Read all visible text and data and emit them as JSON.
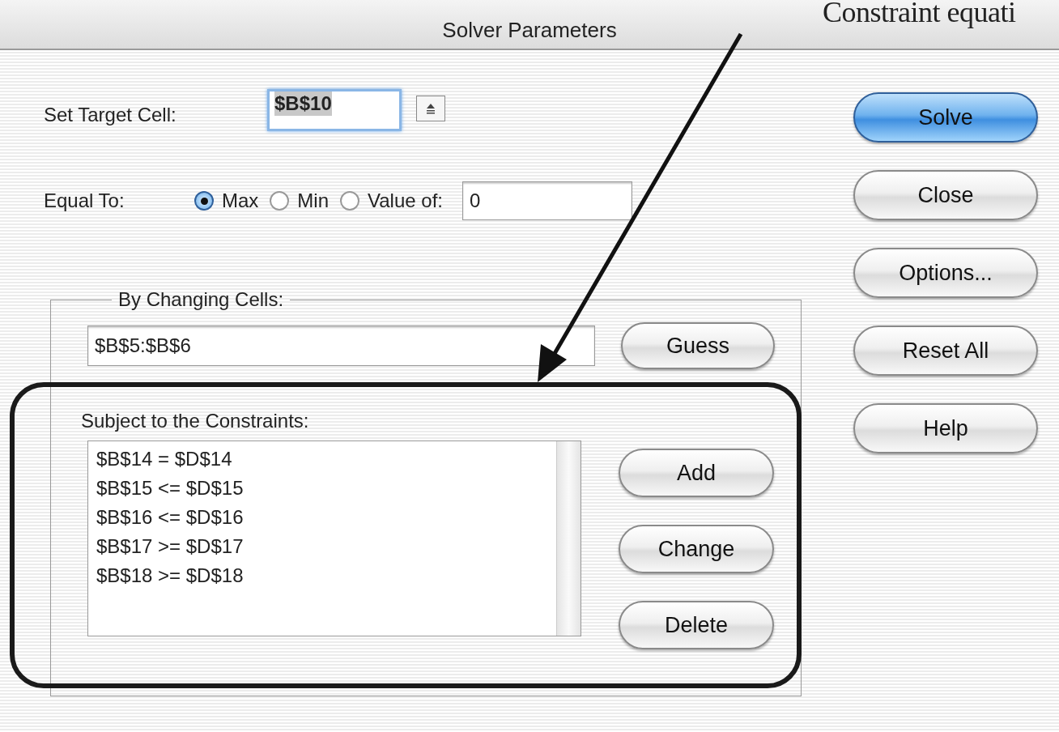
{
  "window": {
    "title": "Solver Parameters"
  },
  "target": {
    "label": "Set Target Cell:",
    "value": "$B$10"
  },
  "equal_to": {
    "label": "Equal To:",
    "options": [
      {
        "label": "Max",
        "selected": true
      },
      {
        "label": "Min",
        "selected": false
      },
      {
        "label": "Value of:",
        "selected": false
      }
    ],
    "value": "0"
  },
  "changing": {
    "legend": "By Changing Cells:",
    "value": "$B$5:$B$6",
    "button": "Guess"
  },
  "constraints": {
    "label": "Subject to the Constraints:",
    "items": [
      "$B$14 = $D$14",
      "$B$15 <= $D$15",
      "$B$16 <= $D$16",
      "$B$17 >= $D$17",
      "$B$18 >= $D$18"
    ],
    "buttons": [
      "Add",
      "Change",
      "Delete"
    ]
  },
  "side_buttons": [
    {
      "label": "Solve",
      "default": true
    },
    {
      "label": "Close",
      "default": false
    },
    {
      "label": "Options...",
      "default": false
    },
    {
      "label": "Reset All",
      "default": false
    },
    {
      "label": "Help",
      "default": false
    }
  ],
  "annotation": {
    "text": "Constraint equati"
  }
}
